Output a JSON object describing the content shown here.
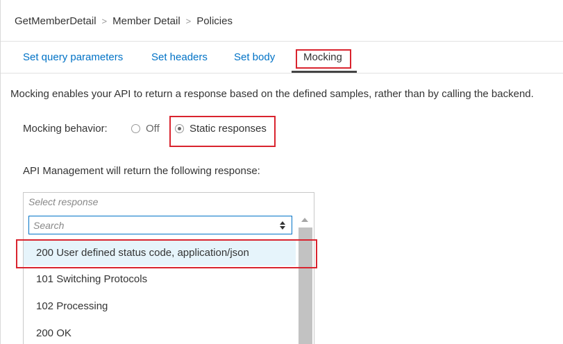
{
  "breadcrumb": [
    "GetMemberDetail",
    "Member Detail",
    "Policies"
  ],
  "breadcrumb_separator": ">",
  "tabs": [
    {
      "label": "Set query parameters"
    },
    {
      "label": "Set headers"
    },
    {
      "label": "Set body"
    },
    {
      "label": "Mocking",
      "active": true
    }
  ],
  "description": "Mocking enables your API to return a response based on the defined samples, rather than by calling the backend.",
  "mocking": {
    "label": "Mocking behavior:",
    "options": [
      {
        "label": "Off",
        "selected": false
      },
      {
        "label": "Static responses",
        "selected": true
      }
    ]
  },
  "response": {
    "prompt": "API Management will return the following response:",
    "select_placeholder": "Select response",
    "search_placeholder": "Search",
    "options": [
      "200 User defined status code, application/json",
      "101 Switching Protocols",
      "102 Processing",
      "200 OK"
    ],
    "highlighted_index": 0
  },
  "colors": {
    "link": "#0072c6",
    "highlight_box": "#d9232e",
    "option_highlight": "#e6f4fb"
  }
}
